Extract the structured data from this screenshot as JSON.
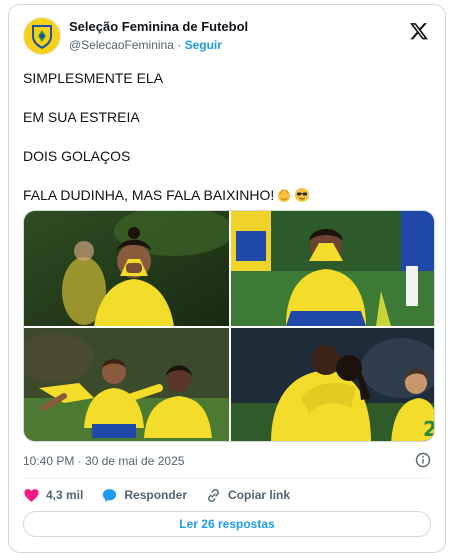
{
  "account": {
    "display_name": "Seleção Feminina de Futebol",
    "handle": "@SelecaoFeminina",
    "separator": "·",
    "follow_label": "Seguir",
    "avatar_icon": "cbf-crest-icon"
  },
  "tweet": {
    "lines": [
      "SIMPLESMENTE ELA",
      "EM SUA ESTREIA",
      "DOIS GOLAÇOS",
      "FALA DUDINHA, MAS FALA BAIXINHO!"
    ],
    "emojis": [
      "pinching-hand-emoji",
      "sunglasses-emoji"
    ],
    "timestamp": "10:40 PM · 30 de mai de 2025"
  },
  "photos": [
    {
      "subject": "player-hands-on-mouth"
    },
    {
      "subject": "player-kneeling-crying"
    },
    {
      "subject": "player-celebrating-run"
    },
    {
      "subject": "players-hugging"
    }
  ],
  "actions": {
    "likes_count": "4,3 mil",
    "reply_label": "Responder",
    "copy_label": "Copiar link",
    "read_replies_label": "Ler 26 respostas"
  },
  "colors": {
    "accent": "#1d9bf0",
    "like": "#f91880",
    "brazil_yellow": "#f7d117",
    "brazil_blue": "#1f4fa8",
    "muted": "#536471"
  }
}
